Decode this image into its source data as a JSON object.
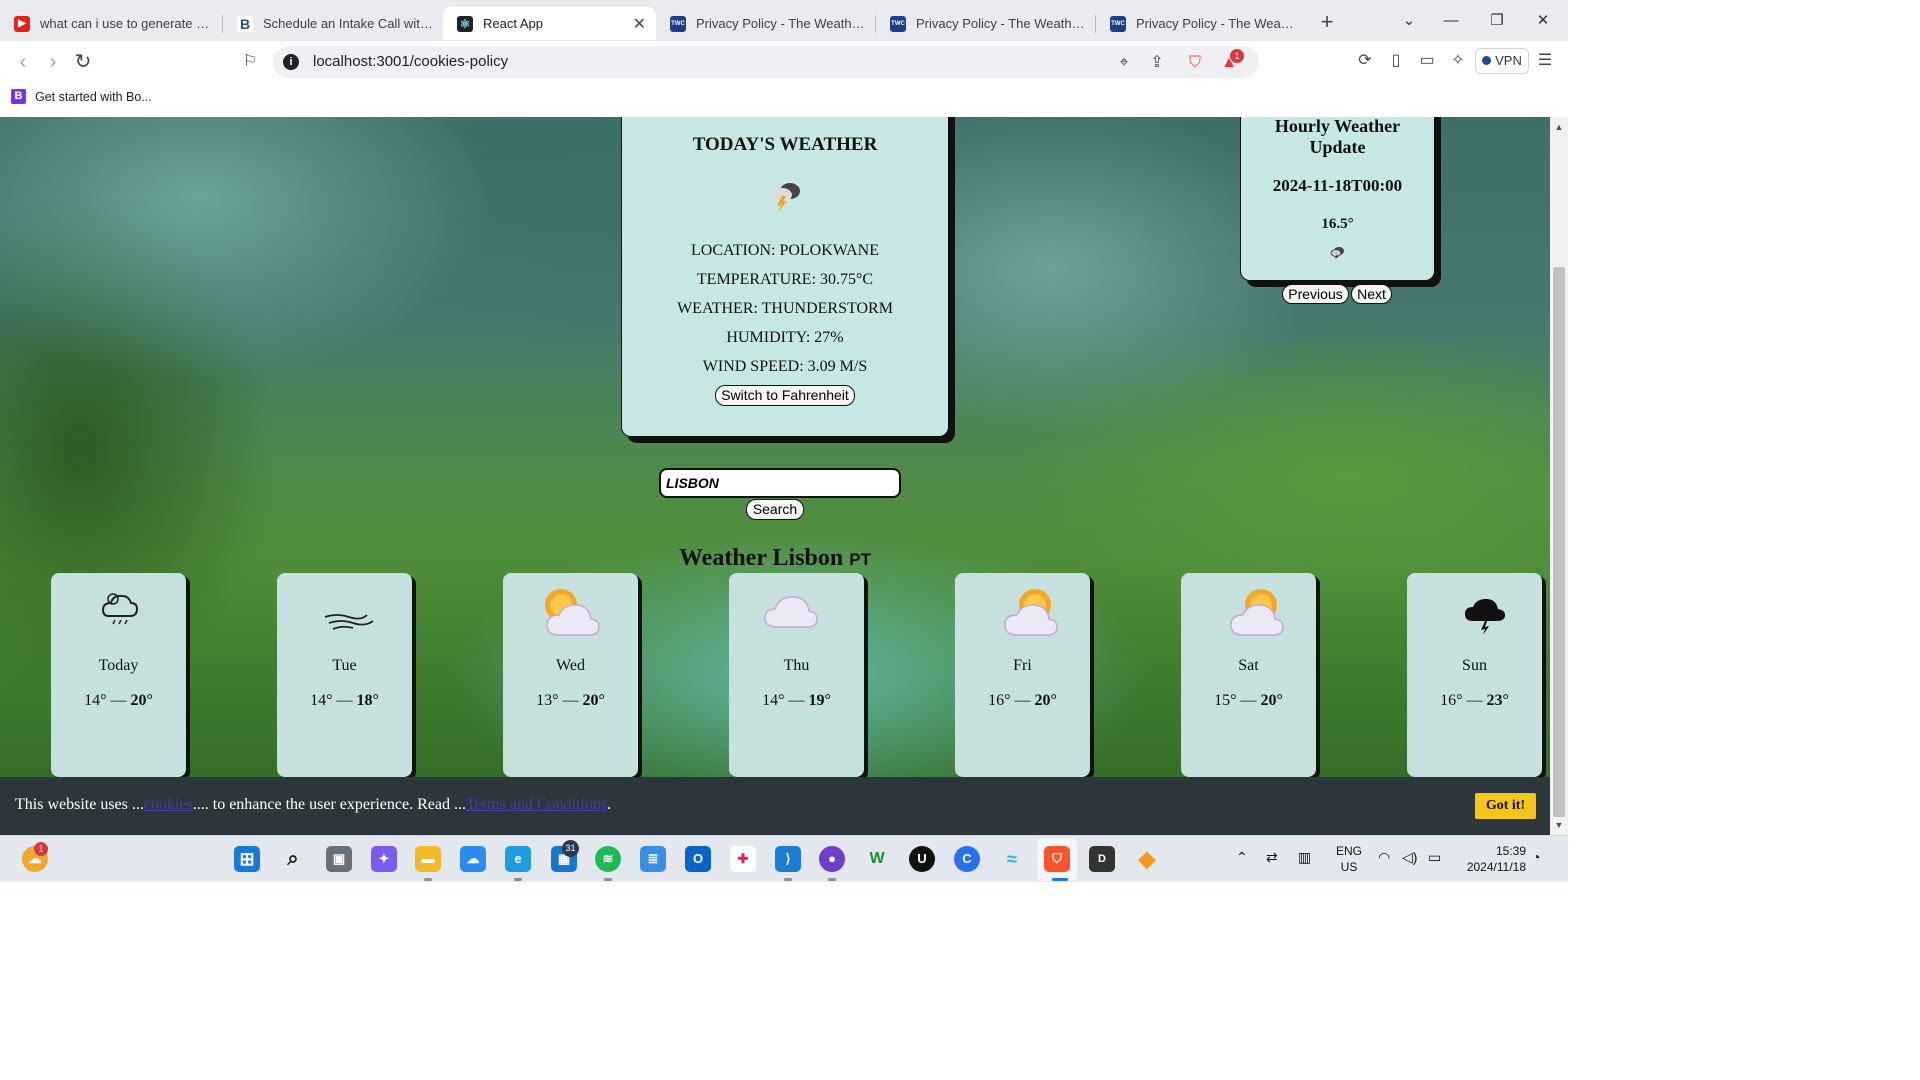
{
  "browser": {
    "tabs": [
      {
        "title": "what can i use to generate term",
        "favicon": "youtube-icon",
        "active": false
      },
      {
        "title": "Schedule an Intake Call with Br",
        "favicon": "b-logo-icon",
        "active": false
      },
      {
        "title": "React App",
        "favicon": "react-icon",
        "active": true
      },
      {
        "title": "Privacy Policy - The Weather Ch",
        "favicon": "weather-channel-icon",
        "active": false
      },
      {
        "title": "Privacy Policy - The Weather Ch",
        "favicon": "weather-channel-icon",
        "active": false
      },
      {
        "title": "Privacy Policy - The Weather Ch",
        "favicon": "weather-channel-icon",
        "active": false
      }
    ],
    "url": "localhost:3001/cookies-policy",
    "vpn_label": "VPN",
    "rewards_badge": "1",
    "bookmark": "Get started with Bo..."
  },
  "today": {
    "title": "TODAY'S WEATHER",
    "icon": "thunderstorm-icon",
    "location": "LOCATION: POLOKWANE",
    "temperature": "TEMPERATURE: 30.75°C",
    "weather": "WEATHER: THUNDERSTORM",
    "humidity": "HUMIDITY: 27%",
    "wind": "WIND SPEED: 3.09 M/S",
    "switch_label": "Switch to Fahrenheit"
  },
  "hourly": {
    "title_line1": "Hourly Weather",
    "title_line2": "Update",
    "time": "2024-11-18T00:00",
    "temp": "16.5°",
    "icon": "thunderstorm-icon",
    "prev_label": "Previous",
    "next_label": "Next"
  },
  "search": {
    "value": "LISBON",
    "button_label": "Search"
  },
  "forecast": {
    "city_title": "Weather Lisbon",
    "country": "PT",
    "days": [
      {
        "day": "Today",
        "low": "14°",
        "high": "20°",
        "icon": "cloud-drizzle-icon"
      },
      {
        "day": "Tue",
        "low": "14°",
        "high": "18°",
        "icon": "wind-icon"
      },
      {
        "day": "Wed",
        "low": "13°",
        "high": "20°",
        "icon": "partly-sunny-icon"
      },
      {
        "day": "Thu",
        "low": "14°",
        "high": "19°",
        "icon": "cloud-icon"
      },
      {
        "day": "Fri",
        "low": "16°",
        "high": "20°",
        "icon": "partly-sunny-icon"
      },
      {
        "day": "Sat",
        "low": "15°",
        "high": "20°",
        "icon": "partly-sunny-icon"
      },
      {
        "day": "Sun",
        "low": "16°",
        "high": "23°",
        "icon": "storm-cloud-icon"
      }
    ],
    "separator": "—"
  },
  "cookie": {
    "text1": "This website uses ...",
    "link1": "cookies",
    "text2": ".... to enhance the user experience. Read ...",
    "link2": "Terms and Conditions",
    "text3": ".",
    "button": "Got it!"
  },
  "taskbar": {
    "lang_line1": "ENG",
    "lang_line2": "US",
    "time": "15:39",
    "date": "2024/11/18",
    "weather_badge": "1",
    "calendar_badge": "31"
  },
  "colors": {
    "card": "#c6e7e4",
    "cookie_bar": "#2b373a",
    "got_it": "#f5c518",
    "link": "#4a3aa8"
  }
}
